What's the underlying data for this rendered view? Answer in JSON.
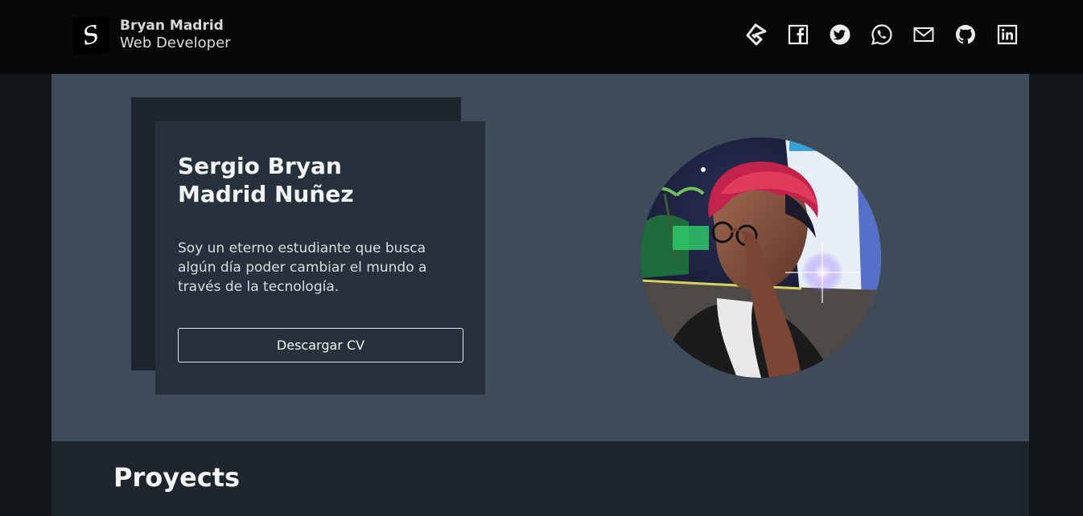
{
  "header": {
    "brand_initial": "S",
    "name": "Bryan Madrid",
    "role": "Web Developer",
    "social_icons": [
      "portfolio-icon",
      "facebook-icon",
      "twitter-icon",
      "whatsapp-icon",
      "email-icon",
      "github-icon",
      "linkedin-icon"
    ]
  },
  "hero": {
    "full_name": "Sergio Bryan Madrid Nuñez",
    "bio": "Soy un eterno estudiante que busca algún día poder cambiar el mundo a través de la tecnología.",
    "cv_button": "Descargar CV"
  },
  "projects": {
    "title": "Proyects"
  },
  "colors": {
    "header_bg": "#07080a",
    "hero_bg": "#3e4c5a",
    "card_bg": "#27313b",
    "section_bg": "#1f252c",
    "page_bg": "#13171c"
  }
}
